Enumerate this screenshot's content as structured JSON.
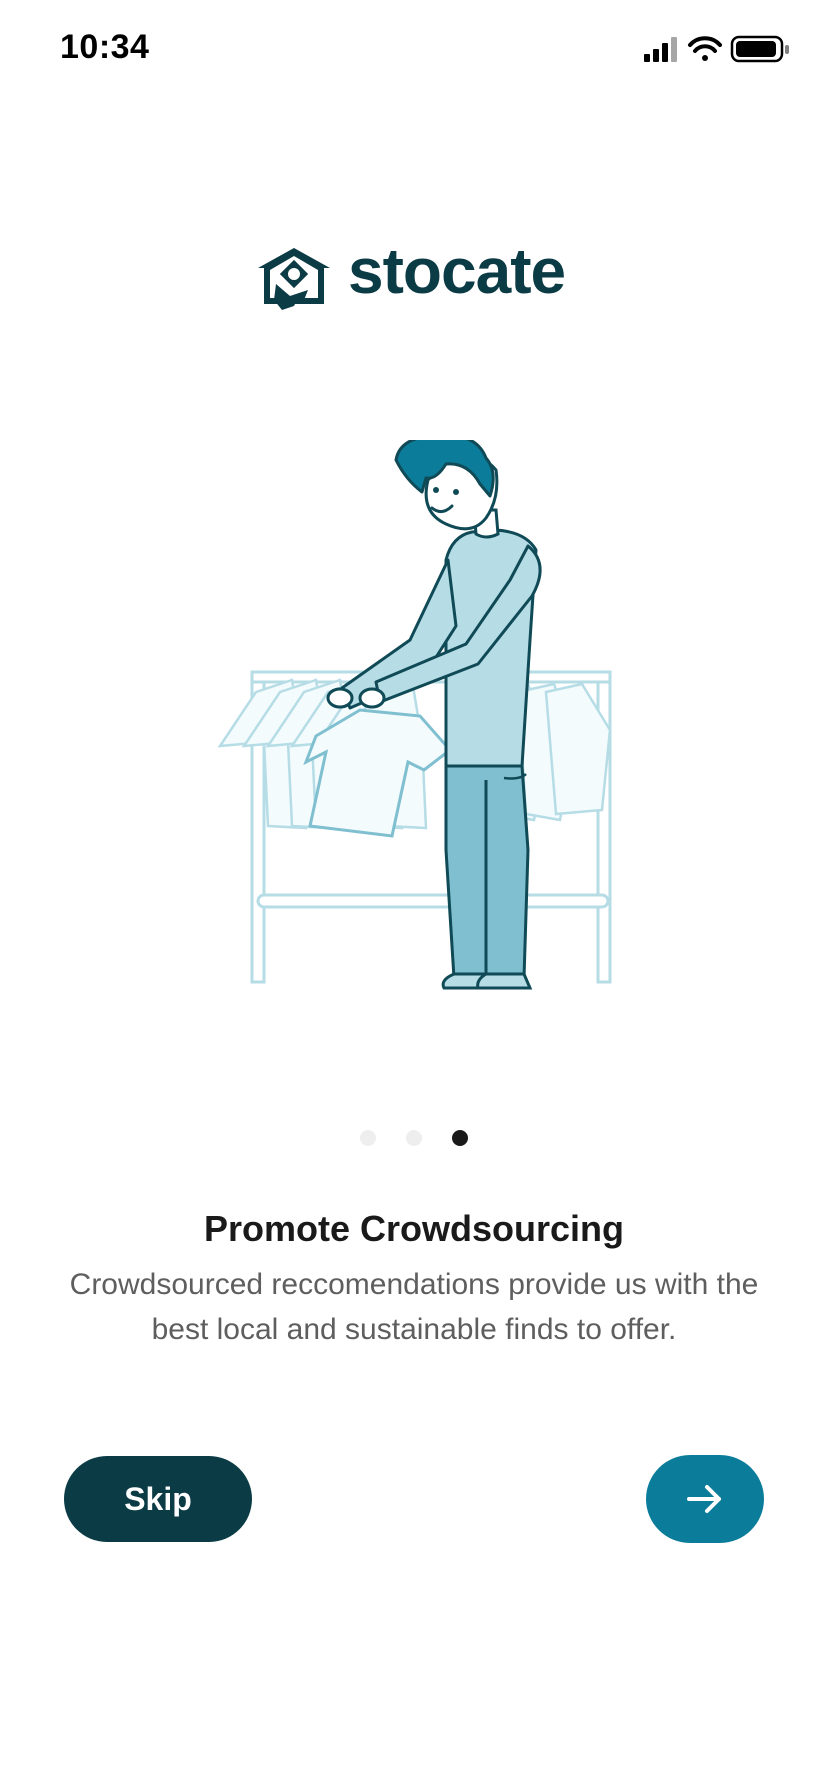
{
  "status_bar": {
    "time": "10:34",
    "icons": [
      "signal-icon",
      "wifi-icon",
      "battery-icon"
    ]
  },
  "logo": {
    "text": "stocate",
    "icon": "logo-house-icon"
  },
  "illustration": {
    "subject": "person-browsing-clothing-rack-illustration"
  },
  "pagination": {
    "total": 3,
    "active_index": 2
  },
  "content": {
    "title": "Promote Crowdsourcing",
    "description": "Crowdsourced reccomendations provide us with the best local and sustainable finds to offer."
  },
  "actions": {
    "skip_label": "Skip",
    "next_icon": "arrow-right-icon"
  },
  "colors": {
    "brand_dark": "#0b3b45",
    "brand_accent": "#0b7d9a",
    "illustration_light": "#b6dce6",
    "illustration_mid": "#7fbfd0",
    "illustration_line": "#0f4a56",
    "dot_inactive": "#eeeeee",
    "dot_active": "#1a1a1a",
    "text_primary": "#1a1a1a",
    "text_secondary": "#5e5e5e"
  }
}
